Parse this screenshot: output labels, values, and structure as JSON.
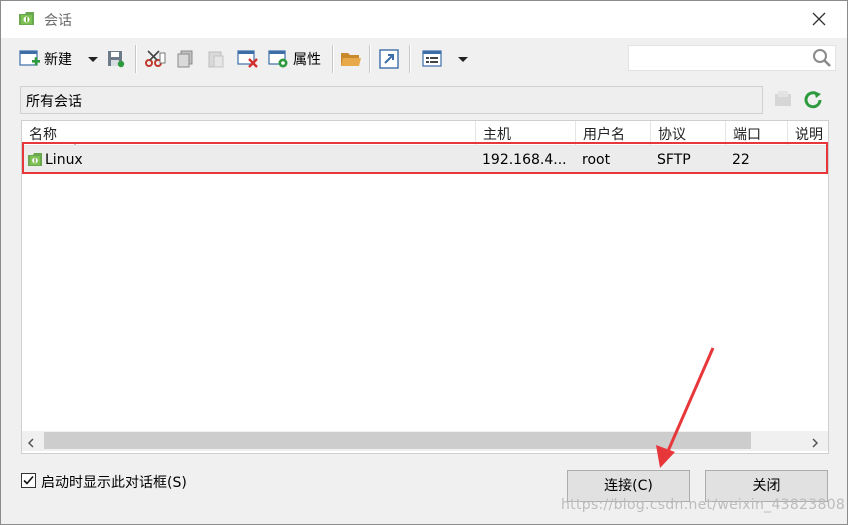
{
  "window": {
    "title": "会话",
    "close_icon": "close-icon"
  },
  "toolbar": {
    "new_label": "新建",
    "properties_label": "属性",
    "icons": [
      "new-session-icon",
      "dropdown-arrow-icon",
      "save-icon",
      "cut-icon",
      "copy-icon",
      "paste-icon",
      "delete-icon",
      "properties-icon",
      "folder-icon",
      "shortcut-icon",
      "view-icon",
      "dropdown-arrow-icon"
    ],
    "search_value": "",
    "search_icon": "search-icon"
  },
  "path": {
    "label": "所有会话"
  },
  "table": {
    "columns": [
      "名称",
      "主机",
      "用户名",
      "协议",
      "端口",
      "说明"
    ],
    "rows": [
      {
        "name": "Linux",
        "host": "192.168.4...",
        "user": "root",
        "protocol": "SFTP",
        "port": "22",
        "desc": ""
      }
    ]
  },
  "footer": {
    "checkbox_label": "启动时显示此对话框(S)",
    "checkbox_checked": true,
    "connect_label": "连接(C)",
    "close_label": "关闭"
  },
  "watermark": "https://blog.csdn.net/weixin_43823808",
  "colors": {
    "highlight": "#e8373a",
    "brand_green": "#5a9e2f"
  }
}
